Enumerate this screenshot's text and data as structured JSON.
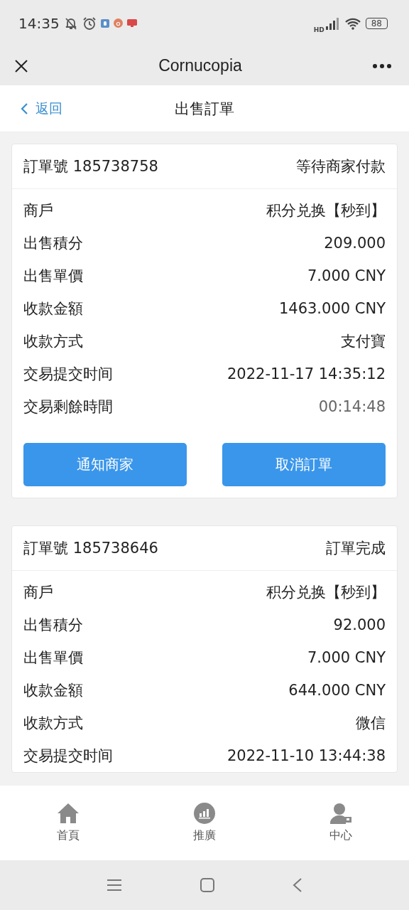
{
  "status_bar": {
    "time": "14:35",
    "network_label": "HD",
    "battery": "88"
  },
  "app_bar": {
    "title": "Cornucopia"
  },
  "page_header": {
    "back_label": "返回",
    "title": "出售訂單"
  },
  "orders": [
    {
      "number": "訂單號 185738758",
      "status": "等待商家付款",
      "rows": [
        {
          "label": "商戶",
          "value": "积分兑换【秒到】",
          "muted": false
        },
        {
          "label": "出售積分",
          "value": "209.000",
          "muted": false
        },
        {
          "label": "出售單價",
          "value": "7.000 CNY",
          "muted": false
        },
        {
          "label": "收款金額",
          "value": "1463.000 CNY",
          "muted": false
        },
        {
          "label": "收款方式",
          "value": "支付寶",
          "muted": false
        },
        {
          "label": "交易提交时间",
          "value": "2022-11-17 14:35:12",
          "muted": false
        },
        {
          "label": "交易剩餘時間",
          "value": "00:14:48",
          "muted": true
        }
      ],
      "actions": [
        "通知商家",
        "取消訂單"
      ]
    },
    {
      "number": "訂單號 185738646",
      "status": "訂單完成",
      "rows": [
        {
          "label": "商戶",
          "value": "积分兑换【秒到】",
          "muted": false
        },
        {
          "label": "出售積分",
          "value": "92.000",
          "muted": false
        },
        {
          "label": "出售單價",
          "value": "7.000 CNY",
          "muted": false
        },
        {
          "label": "收款金額",
          "value": "644.000 CNY",
          "muted": false
        },
        {
          "label": "收款方式",
          "value": "微信",
          "muted": false
        },
        {
          "label": "交易提交时间",
          "value": "2022-11-10 13:44:38",
          "muted": false
        }
      ]
    }
  ],
  "tab_bar": [
    {
      "kind": "home",
      "label": "首頁"
    },
    {
      "kind": "chart",
      "label": "推廣"
    },
    {
      "kind": "user",
      "label": "中心"
    }
  ]
}
